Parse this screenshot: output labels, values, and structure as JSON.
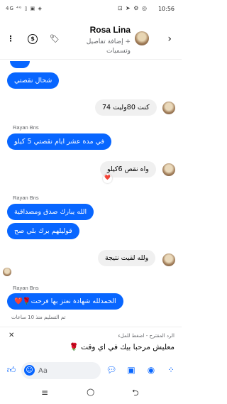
{
  "status_bar": {
    "time": "10:56",
    "left_indicators": "4G ⁴ᴳ ▯ ▣ ◈",
    "right_indicators": "⊡ ➤ ⚙ ◎"
  },
  "header": {
    "contact_name": "Rosa Lina",
    "subtitle": "+ إضافة تفاصيل وتسميات"
  },
  "messages": [
    {
      "kind": "in",
      "text": "شحال نقصتي"
    },
    {
      "kind": "out",
      "text": "كنت 80وليت 74"
    },
    {
      "kind": "sender",
      "text": "Rayan Bns"
    },
    {
      "kind": "in",
      "text": "في مدة عشر ايام نقصتي 5 كيلو"
    },
    {
      "kind": "out",
      "text": "واه نقص 6كيلو",
      "reaction": "❤️"
    },
    {
      "kind": "sender",
      "text": "Rayan Bns"
    },
    {
      "kind": "in",
      "text": "الله يبارك صدق ومصداقية"
    },
    {
      "kind": "in",
      "text": "قوليلهم برك بلي صح"
    },
    {
      "kind": "out",
      "text": "ولله لقيت نتيجة"
    },
    {
      "kind": "sender",
      "text": "Rayan Bns"
    },
    {
      "kind": "in",
      "text": "الحمدلله شهادة نعتز بها فرحت🌹❤️"
    }
  ],
  "delivered_status": "تم التسليم منذ 10 ساعات",
  "suggested_reply": {
    "hint": "الرد المقترح - اضغط للملء",
    "text": "معليش مرحبا بيك في اي وقت 🌹"
  },
  "composer": {
    "placeholder": "Aa"
  },
  "icons": {
    "more": "more-vertical-icon",
    "payment": "dollar-icon",
    "tag": "tag-icon",
    "back": "chevron-right-icon",
    "like": "thumbs-up-icon",
    "emoji": "emoji-icon",
    "chat": "chat-bubble-icon",
    "gallery": "image-icon",
    "camera": "camera-icon",
    "apps": "apps-grid-icon"
  },
  "colors": {
    "accent": "#0866ff",
    "incoming_bubble": "#0866ff",
    "outgoing_bubble": "#f0f0f0"
  }
}
